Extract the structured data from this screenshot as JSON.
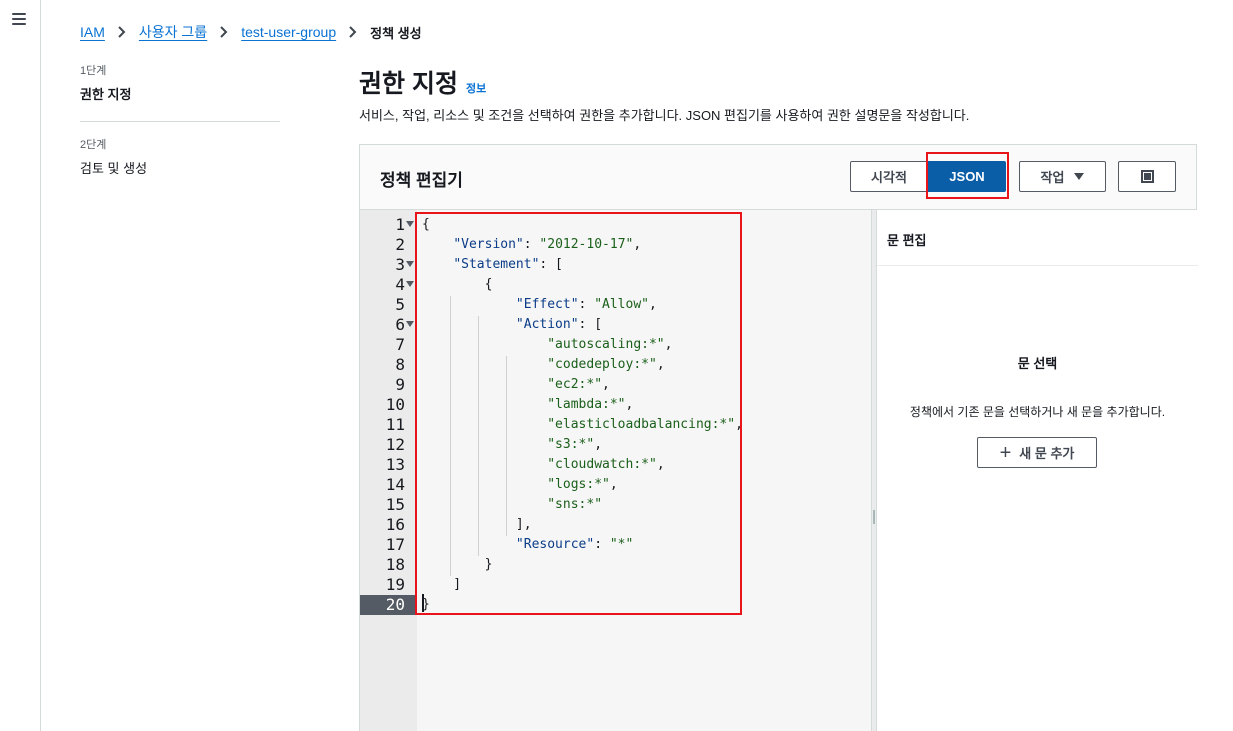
{
  "breadcrumb": [
    {
      "label": "IAM",
      "link": true
    },
    {
      "label": "사용자 그룹",
      "link": true
    },
    {
      "label": "test-user-group",
      "link": true
    },
    {
      "label": "정책 생성",
      "link": false
    }
  ],
  "steps": [
    {
      "num": "1단계",
      "title": "권한 지정",
      "active": true
    },
    {
      "num": "2단계",
      "title": "검토 및 생성",
      "active": false
    }
  ],
  "header": {
    "title": "권한 지정",
    "info": "정보",
    "description": "서비스, 작업, 리소스 및 조건을 선택하여 권한을 추가합니다. JSON 편집기를 사용하여 권한 설명문을 작성합니다."
  },
  "panel": {
    "title": "정책 편집기",
    "visual_label": "시각적",
    "json_label": "JSON",
    "action_label": "작업",
    "fullscreen_icon": "fullscreen-icon"
  },
  "editor": {
    "active_line": 20,
    "lines": [
      {
        "n": "1",
        "text": "{"
      },
      {
        "n": "2",
        "text": "    \"Version\": \"2012-10-17\","
      },
      {
        "n": "3",
        "text": "    \"Statement\": ["
      },
      {
        "n": "4",
        "text": "        {"
      },
      {
        "n": "5",
        "text": "            \"Effect\": \"Allow\","
      },
      {
        "n": "6",
        "text": "            \"Action\": ["
      },
      {
        "n": "7",
        "text": "                \"autoscaling:*\","
      },
      {
        "n": "8",
        "text": "                \"codedeploy:*\","
      },
      {
        "n": "9",
        "text": "                \"ec2:*\","
      },
      {
        "n": "10",
        "text": "                \"lambda:*\","
      },
      {
        "n": "11",
        "text": "                \"elasticloadbalancing:*\","
      },
      {
        "n": "12",
        "text": "                \"s3:*\","
      },
      {
        "n": "13",
        "text": "                \"cloudwatch:*\","
      },
      {
        "n": "14",
        "text": "                \"logs:*\","
      },
      {
        "n": "15",
        "text": "                \"sns:*\""
      },
      {
        "n": "16",
        "text": "            ],"
      },
      {
        "n": "17",
        "text": "            \"Resource\": \"*\""
      },
      {
        "n": "18",
        "text": "        }"
      },
      {
        "n": "19",
        "text": "    ]"
      },
      {
        "n": "20",
        "text": "}"
      }
    ]
  },
  "side": {
    "head": "문 편집",
    "title": "문 선택",
    "description": "정책에서 기존 문을 선택하거나 새 문을 추가합니다.",
    "add_label": "새 문 추가"
  },
  "colors": {
    "accent": "#0972d3",
    "json_active": "#0a5ea8",
    "highlight": "#e8141a"
  }
}
